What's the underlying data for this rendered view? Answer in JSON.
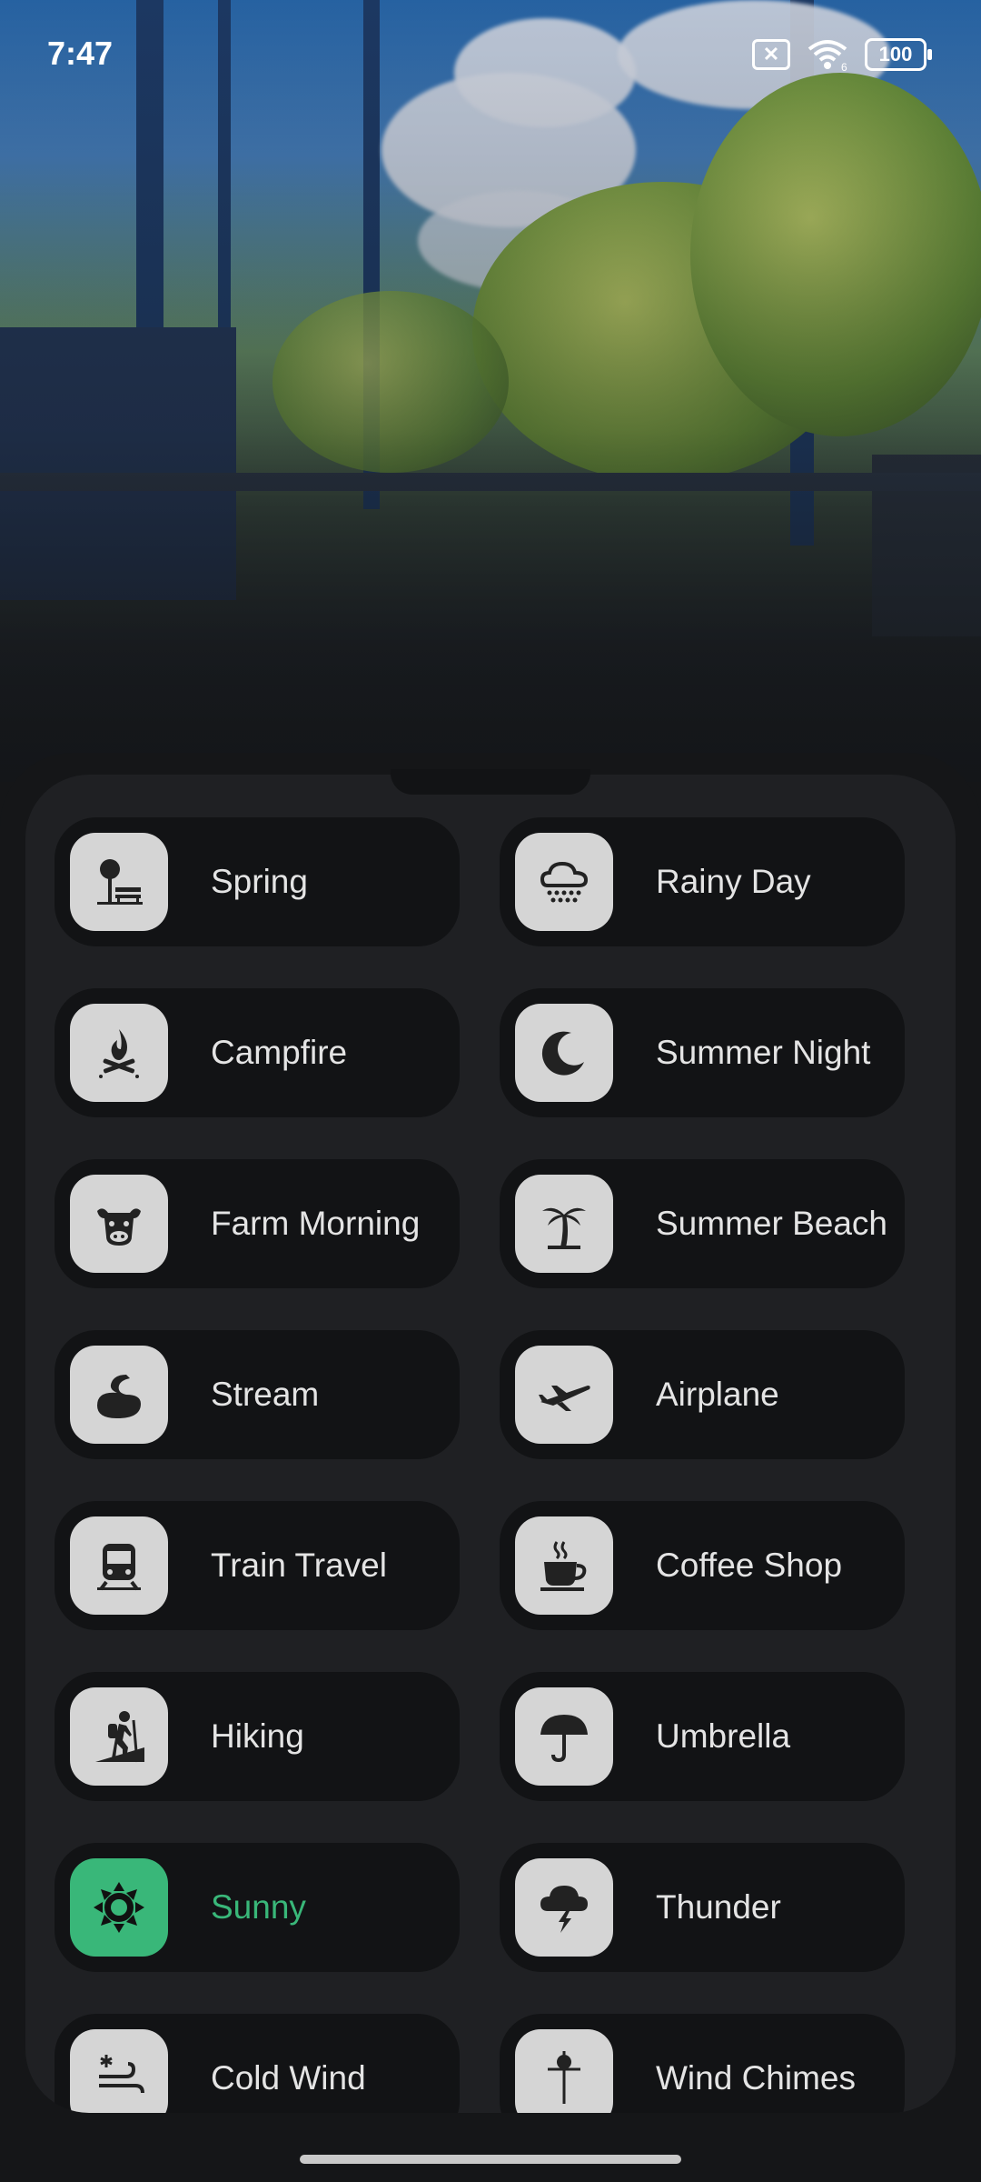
{
  "status": {
    "time": "7:47",
    "battery": "100",
    "sim_badge": "6"
  },
  "sounds": [
    {
      "label": "Spring",
      "icon": "park-bench-tree-icon",
      "active": false
    },
    {
      "label": "Rainy Day",
      "icon": "rain-cloud-icon",
      "active": false
    },
    {
      "label": "Campfire",
      "icon": "campfire-icon",
      "active": false
    },
    {
      "label": "Summer Night",
      "icon": "crescent-moon-icon",
      "active": false
    },
    {
      "label": "Farm Morning",
      "icon": "cow-icon",
      "active": false
    },
    {
      "label": "Summer Beach",
      "icon": "palm-tree-icon",
      "active": false
    },
    {
      "label": "Stream",
      "icon": "water-stream-icon",
      "active": false
    },
    {
      "label": "Airplane",
      "icon": "airplane-icon",
      "active": false
    },
    {
      "label": "Train Travel",
      "icon": "train-icon",
      "active": false
    },
    {
      "label": "Coffee Shop",
      "icon": "coffee-cup-icon",
      "active": false
    },
    {
      "label": "Hiking",
      "icon": "hiker-icon",
      "active": false
    },
    {
      "label": "Umbrella",
      "icon": "umbrella-icon",
      "active": false
    },
    {
      "label": "Sunny",
      "icon": "sun-icon",
      "active": true
    },
    {
      "label": "Thunder",
      "icon": "thunder-cloud-icon",
      "active": false
    },
    {
      "label": "Cold Wind",
      "icon": "cold-wind-icon",
      "active": false
    },
    {
      "label": "Wind Chimes",
      "icon": "wind-chimes-icon",
      "active": false
    }
  ],
  "colors": {
    "accent": "#39b779",
    "card_bg": "#121315",
    "icon_tile": "#d5d5d5",
    "text": "#e4e4e4"
  }
}
